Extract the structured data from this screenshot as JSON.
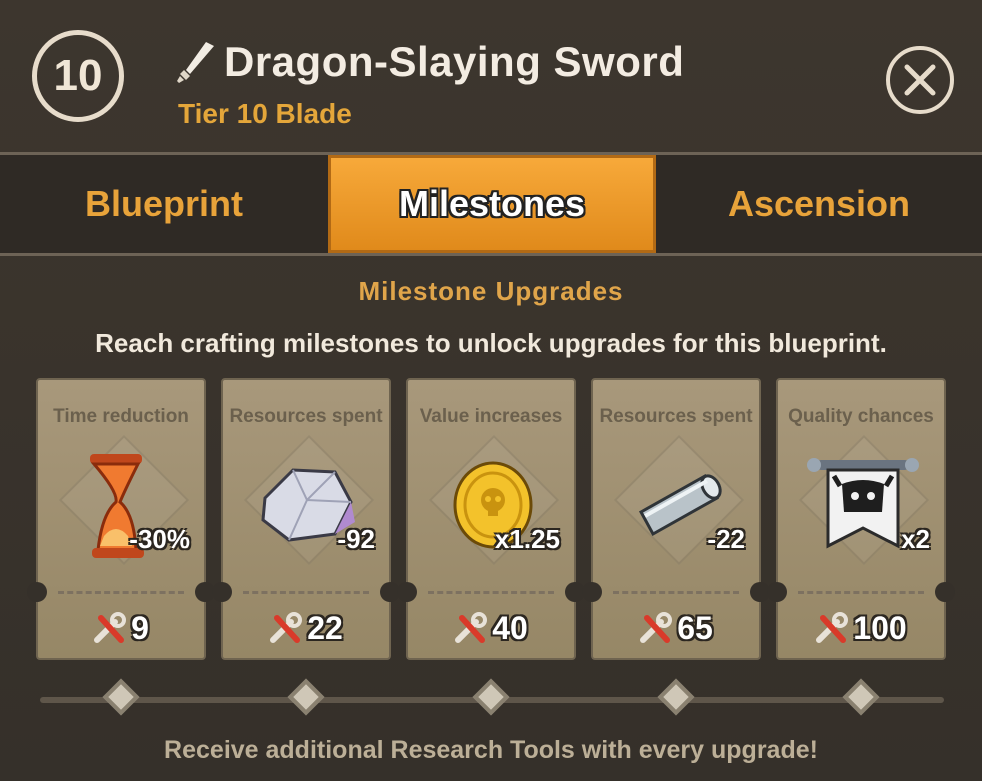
{
  "header": {
    "level": "10",
    "title": "Dragon-Slaying Sword",
    "subtitle": "Tier 10 Blade",
    "icon": "sword-icon",
    "close_icon": "close-icon"
  },
  "tabs": [
    {
      "label": "Blueprint",
      "active": false
    },
    {
      "label": "Milestones",
      "active": true
    },
    {
      "label": "Ascension",
      "active": false
    }
  ],
  "section": {
    "title": "Milestone Upgrades",
    "description": "Reach crafting milestones to unlock upgrades for this blueprint."
  },
  "cards": [
    {
      "label": "Time reduction",
      "icon": "hourglass-icon",
      "value": "-30%",
      "cost": "9"
    },
    {
      "label": "Resources spent",
      "icon": "ore-icon",
      "value": "-92",
      "cost": "22"
    },
    {
      "label": "Value increases",
      "icon": "coin-icon",
      "value": "x1.25",
      "cost": "40"
    },
    {
      "label": "Resources spent",
      "icon": "metal-bar-icon",
      "value": "-22",
      "cost": "65"
    },
    {
      "label": "Quality chances",
      "icon": "banner-icon",
      "value": "x2",
      "cost": "100"
    }
  ],
  "footer": "Receive additional Research Tools with every upgrade!",
  "colors": {
    "accent": "#e8a33a",
    "active_tab": "#f29b2a",
    "panel": "#3a332b",
    "card": "#a0916f"
  }
}
